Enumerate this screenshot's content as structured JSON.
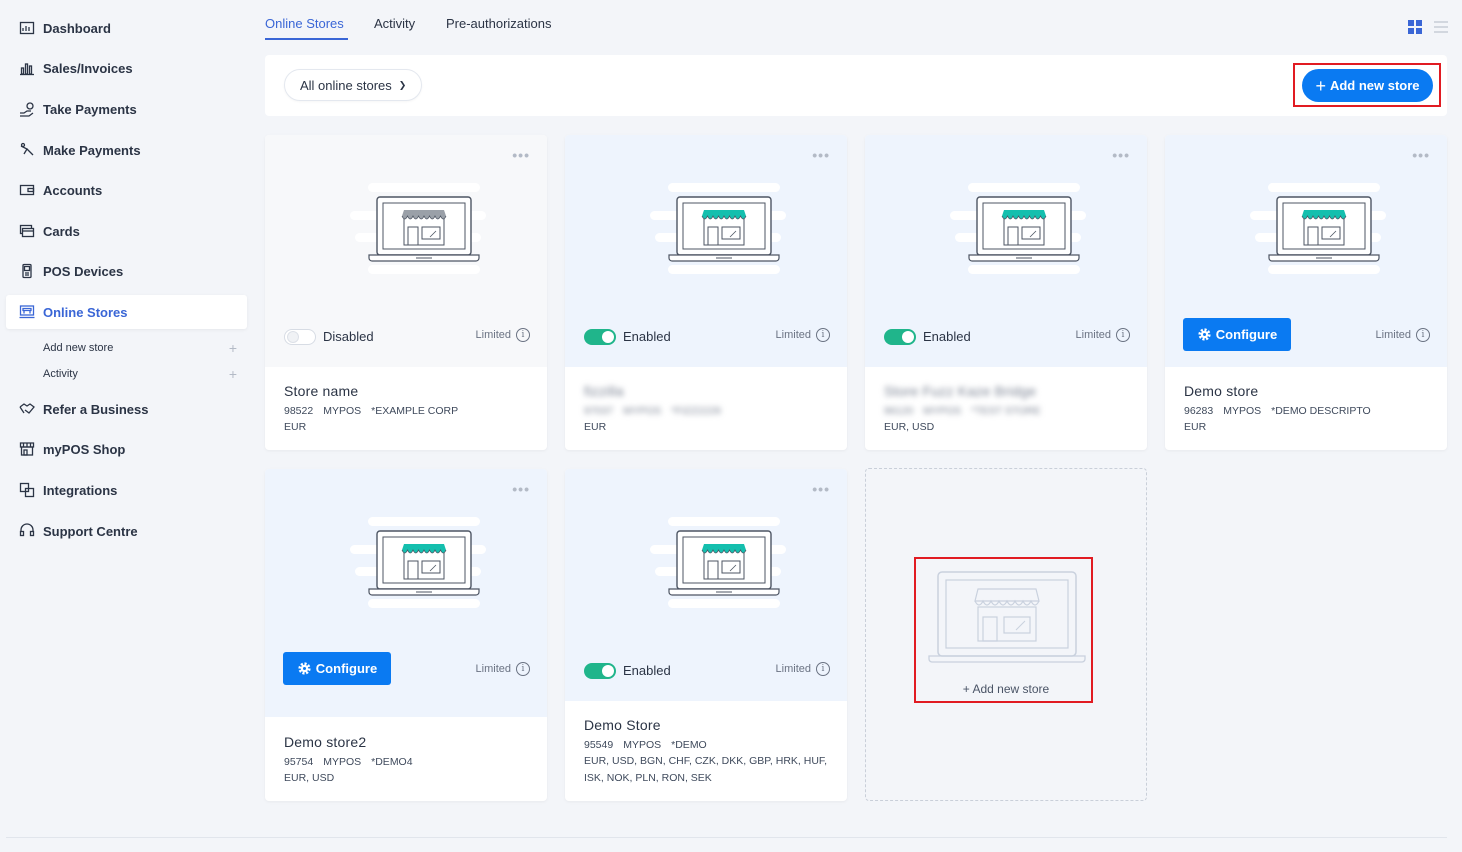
{
  "sidebar": {
    "items": [
      {
        "label": "Dashboard",
        "icon": "dashboard-icon"
      },
      {
        "label": "Sales/Invoices",
        "icon": "bar-chart-icon"
      },
      {
        "label": "Take Payments",
        "icon": "take-payments-icon"
      },
      {
        "label": "Make Payments",
        "icon": "make-payments-icon"
      },
      {
        "label": "Accounts",
        "icon": "wallet-icon"
      },
      {
        "label": "Cards",
        "icon": "cards-icon"
      },
      {
        "label": "POS Devices",
        "icon": "pos-device-icon"
      },
      {
        "label": "Online Stores",
        "icon": "online-store-icon"
      },
      {
        "label": "Refer a Business",
        "icon": "handshake-icon"
      },
      {
        "label": "myPOS Shop",
        "icon": "shop-icon"
      },
      {
        "label": "Integrations",
        "icon": "integrations-icon"
      },
      {
        "label": "Support Centre",
        "icon": "support-icon"
      }
    ],
    "subitems": [
      {
        "label": "Add new store"
      },
      {
        "label": "Activity"
      }
    ]
  },
  "tabs": [
    {
      "label": "Online Stores"
    },
    {
      "label": "Activity"
    },
    {
      "label": "Pre-authorizations"
    }
  ],
  "toolbar": {
    "filter_label": "All online stores",
    "add_store_label": "Add new store"
  },
  "colors": {
    "accent": "#0a7af2",
    "enabled": "#20b58b",
    "highlight": "#e11b22",
    "awning": "#14bfae"
  },
  "stores": [
    {
      "status": "Disabled",
      "limited": "Limited",
      "name": "Store name",
      "id": "98522",
      "brand": "MYPOS",
      "descriptor": "*EXAMPLE CORP",
      "currencies": "EUR"
    },
    {
      "status": "Enabled",
      "limited": "Limited",
      "name": "fizzilla",
      "id": "97037",
      "brand": "MYPOS",
      "descriptor": "*FIZZ2229",
      "currencies": "EUR"
    },
    {
      "status": "Enabled",
      "limited": "Limited",
      "name": "Store Fuzz Kaze Bridge",
      "id": "96120",
      "brand": "MYPOS",
      "descriptor": "*TEST STORE",
      "currencies": "EUR, USD"
    },
    {
      "status": "Configure",
      "limited": "Limited",
      "name": "Demo store",
      "id": "96283",
      "brand": "MYPOS",
      "descriptor": "*DEMO DESCRIPTO",
      "currencies": "EUR"
    },
    {
      "status": "Configure",
      "limited": "Limited",
      "name": "Demo store2",
      "id": "95754",
      "brand": "MYPOS",
      "descriptor": "*DEMO4",
      "currencies": "EUR, USD"
    },
    {
      "status": "Enabled",
      "limited": "Limited",
      "name": "Demo Store",
      "id": "95549",
      "brand": "MYPOS",
      "descriptor": "*DEMO",
      "currencies": "EUR, USD, BGN, CHF, CZK, DKK, GBP, HRK, HUF, ISK, NOK, PLN, RON, SEK"
    }
  ],
  "add_card": {
    "label": "+ Add new store"
  }
}
